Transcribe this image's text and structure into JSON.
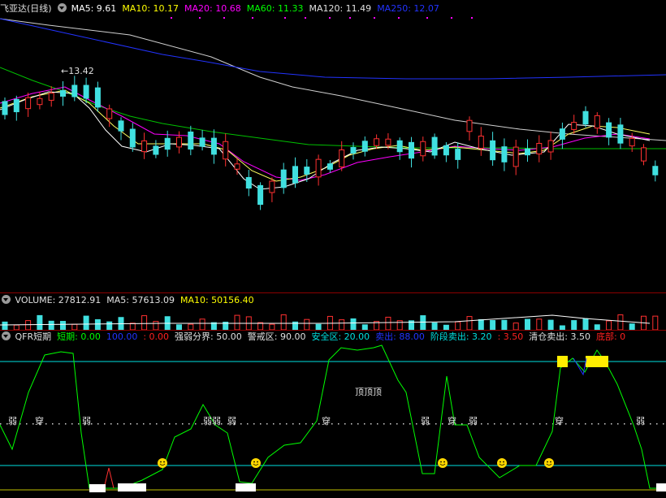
{
  "main": {
    "title": "飞亚达(日线)",
    "ma_labels": [
      {
        "text": "MA5: 9.61",
        "color": "#ffffff"
      },
      {
        "text": "MA10: 10.17",
        "color": "#ffff00"
      },
      {
        "text": "MA20: 10.68",
        "color": "#ff00ff"
      },
      {
        "text": "MA60: 11.33",
        "color": "#00ff00"
      },
      {
        "text": "MA120: 11.49",
        "color": "#e0e0e0"
      },
      {
        "text": "MA250: 12.07",
        "color": "#2233ff"
      }
    ],
    "high_label": "13.42"
  },
  "volume": {
    "labels": [
      {
        "text": "VOLUME: 27812.91",
        "color": "#e0e0e0"
      },
      {
        "text": "MA5: 57613.09",
        "color": "#e0e0e0"
      },
      {
        "text": "MA10: 50156.40",
        "color": "#ffff00"
      }
    ]
  },
  "indicator": {
    "labels": [
      {
        "text": "QFR短期",
        "color": "#e0e0e0"
      },
      {
        "text": "短期: 0.00",
        "color": "#00ff00"
      },
      {
        "text": "100.00",
        "color": "#2233ff"
      },
      {
        "text": ": 0.00",
        "color": "#ff2020"
      },
      {
        "text": "强弱分界: 50.00",
        "color": "#e0e0e0"
      },
      {
        "text": "警戒区: 90.00",
        "color": "#e0e0e0"
      },
      {
        "text": "安全区: 20.00",
        "color": "#00e0e0"
      },
      {
        "text": "卖出: 88.00",
        "color": "#2233ff"
      },
      {
        "text": "阶段卖出: 3.20",
        "color": "#00e0e0"
      },
      {
        "text": ": 3.50",
        "color": "#ff2020"
      },
      {
        "text": "清仓卖出: 3.50",
        "color": "#e0e0e0"
      },
      {
        "text": "底部: 0",
        "color": "#ff2020"
      }
    ],
    "markers": [
      "弱",
      "穿",
      "弱",
      "弱弱",
      "弱",
      "穿",
      "弱",
      "穿",
      "弱",
      "穿",
      "弱"
    ],
    "top_text": "顶顶顶",
    "colors": {
      "line": "#00ff00",
      "guide": "#00e0e0",
      "dots": "#ff00ff"
    }
  }
}
